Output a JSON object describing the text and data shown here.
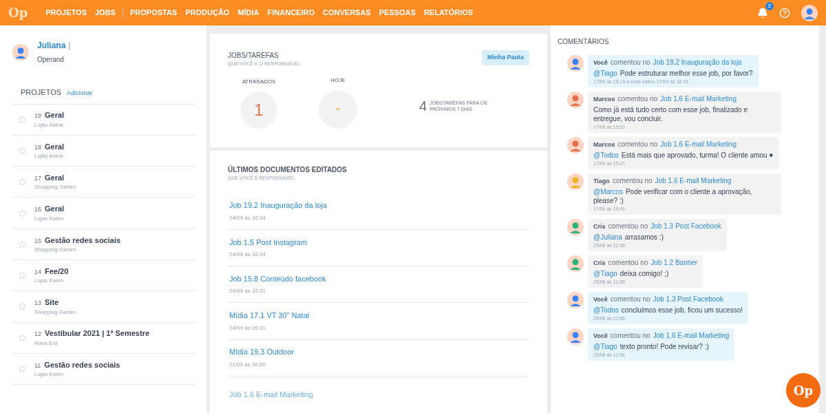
{
  "topbar": {
    "logo": "Op",
    "nav": [
      {
        "label": "PROJETOS"
      },
      {
        "label": "JOBS"
      },
      {
        "label": "PROPOSTAS"
      },
      {
        "label": "PRODUÇÃO"
      },
      {
        "label": "MÍDIA"
      },
      {
        "label": "FINANCEIRO"
      },
      {
        "label": "CONVERSAS"
      },
      {
        "label": "PESSOAS"
      },
      {
        "label": "RELATÓRIOS"
      }
    ],
    "notifications": "2"
  },
  "profile": {
    "name": "Juliana",
    "separator": "|",
    "company": "Operand"
  },
  "projects": {
    "title": "PROJETOS",
    "add": "Adicionar",
    "items": [
      {
        "number": "19",
        "name": "Geral",
        "client": "Lojão Astral",
        "starred": false
      },
      {
        "number": "18",
        "name": "Geral",
        "client": "Lojão Astral",
        "starred": false
      },
      {
        "number": "17",
        "name": "Geral",
        "client": "Shopping Garten",
        "starred": false
      },
      {
        "number": "16",
        "name": "Geral",
        "client": "Lojas Karim",
        "starred": false
      },
      {
        "number": "15",
        "name": "Gestão redes sociais",
        "client": "Shopping Garten",
        "starred": false
      },
      {
        "number": "14",
        "name": "Fee/20",
        "client": "Lojas Karim",
        "starred": false
      },
      {
        "number": "13",
        "name": "Site",
        "client": "Shopping Garten",
        "starred": false
      },
      {
        "number": "12",
        "name": "Vestibular 2021 | 1º Semestre",
        "client": "Nova Era",
        "starred": false
      },
      {
        "number": "11",
        "name": "Gestão redes sociais",
        "client": "Lojas Karim",
        "starred": false
      }
    ]
  },
  "tasks": {
    "title": "JOBS/TAREFAS",
    "subtitle": "QUE VOCÊ É O RESPONSÁVEL",
    "button": "Minha Pauta",
    "late_label": "ATRASADOS",
    "late_value": "1",
    "today_label": "HOJE",
    "today_value": "-",
    "week_value": "4",
    "week_label": "JOBS/TAREFAS PARA OS PRÓXIMOS 7 DIAS"
  },
  "documents": {
    "title": "ÚLTIMOS DOCUMENTOS EDITADOS",
    "subtitle": "QUE VOCÊ É RESPONSÁVEL",
    "items": [
      {
        "title": "Job 19.2 Inauguração da loja",
        "time": "24/09 às 10:34"
      },
      {
        "title": "Job 1.5 Post Instagram",
        "time": "24/09 às 10:34"
      },
      {
        "title": "Job 15.8 Conteúdo facebook",
        "time": "24/09 às 10:31"
      },
      {
        "title": "Mídia 17.1 VT 30\" Natal",
        "time": "24/09 às 09:31"
      },
      {
        "title": "Mídia 19.3 Outdoor",
        "time": "21/09 às 10:50"
      },
      {
        "title": "Job 1.6 E-mail Marketing"
      }
    ]
  },
  "comments": {
    "title": "COMENTÁRIOS",
    "items": [
      {
        "author": "Você",
        "verb": "comentou no",
        "job": "Job 19.2 Inauguração da loja",
        "mention": "@Tiago",
        "text": "Pode estruturar melhor esse job, por favor?",
        "time": "17/09 às 16:15 e você editou 17/09 às 16:16",
        "own": true,
        "color": "#3b82f6"
      },
      {
        "author": "Marcos",
        "verb": "comentou no",
        "job": "Job 1.6 E-mail Marketing",
        "text": "Como já está tudo certo com esse job, finalizado e entregue, vou concluir.",
        "time": "17/09 às 15:51",
        "own": false,
        "color": "#e2704a"
      },
      {
        "author": "Marcos",
        "verb": "comentou no",
        "job": "Job 1.6 E-mail Marketing",
        "mention": "@Todos",
        "text": "Está mais que aprovado, turma! O cliente amou ♥",
        "time": "17/09 às 15:47",
        "own": false,
        "color": "#e2704a"
      },
      {
        "author": "Tiago",
        "verb": "comentou no",
        "job": "Job 1.6 E-mail Marketing",
        "mention": "@Marcos",
        "text": "Pode verificar com o cliente a aprovação, please? :)",
        "time": "17/09 às 15:41",
        "own": false,
        "color": "#f0b429"
      },
      {
        "author": "Cris",
        "verb": "comentou no",
        "job": "Job 1.3 Post Facebook",
        "mention": "@Juliana",
        "text": "arrasamos :)",
        "time": "25/08 às 11:58",
        "own": false,
        "color": "#2fb37a"
      },
      {
        "author": "Cris",
        "verb": "comentou no",
        "job": "Job 1.2 Banner",
        "mention": "@Tiago",
        "text": "deixa comigo! ;)",
        "time": "25/08 às 11:58",
        "own": false,
        "color": "#2fb37a"
      },
      {
        "author": "Você",
        "verb": "comentou no",
        "job": "Job 1.3 Post Facebook",
        "mention": "@Todos",
        "text": "concluímos esse job, ficou um sucesso!",
        "time": "25/08 às 11:56",
        "own": true,
        "color": "#3b82f6"
      },
      {
        "author": "Você",
        "verb": "comentou no",
        "job": "Job 1.6 E-mail Marketing",
        "mention": "@Tiago",
        "text": "texto pronto! Pode revisar? :)",
        "time": "25/08 às 11:56",
        "own": true,
        "color": "#3b82f6"
      }
    ]
  },
  "chat_logo": "Op"
}
